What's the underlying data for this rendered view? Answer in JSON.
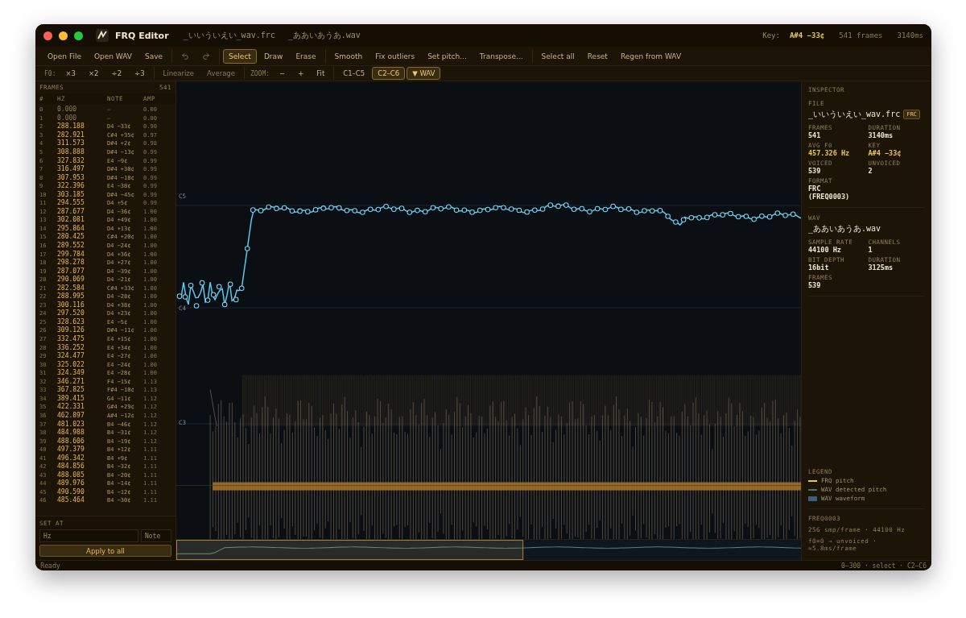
{
  "window": {
    "title": "FRQ Editor",
    "files": [
      "_いいういえい_wav.frc",
      "_ああいあうあ.wav"
    ],
    "key_label": "Key:",
    "key_value": "A#4 −33¢",
    "frames": "541 frames",
    "duration": "3140ms"
  },
  "toolbar": [
    [
      {
        "kind": "text",
        "label": "Open File",
        "selected": false,
        "disabled": false
      },
      {
        "kind": "text",
        "label": "Open WAV",
        "selected": false,
        "disabled": false
      },
      {
        "kind": "text",
        "label": "Save",
        "selected": false,
        "disabled": false
      }
    ],
    [
      {
        "kind": "undo",
        "selected": false,
        "disabled": true
      },
      {
        "kind": "redo",
        "selected": false,
        "disabled": true
      }
    ],
    [
      {
        "kind": "text",
        "label": "Select",
        "selected": true,
        "disabled": false
      },
      {
        "kind": "text",
        "label": "Draw",
        "selected": false,
        "disabled": false
      },
      {
        "kind": "text",
        "label": "Erase",
        "selected": false,
        "disabled": false
      }
    ],
    [
      {
        "kind": "text",
        "label": "Smooth",
        "selected": false,
        "disabled": false
      },
      {
        "kind": "text",
        "label": "Fix outliers",
        "selected": false,
        "disabled": false
      },
      {
        "kind": "text",
        "label": "Set pitch...",
        "selected": false,
        "disabled": false
      },
      {
        "kind": "text",
        "label": "Transpose...",
        "selected": false,
        "disabled": false
      }
    ],
    [
      {
        "kind": "text",
        "label": "Select all",
        "selected": false,
        "disabled": false
      },
      {
        "kind": "text",
        "label": "Reset",
        "selected": false,
        "disabled": false
      },
      {
        "kind": "text",
        "label": "Regen from WAV",
        "selected": false,
        "disabled": false
      }
    ]
  ],
  "toolbar2": [
    [
      {
        "kind": "label",
        "label": "F0:"
      },
      {
        "kind": "text",
        "label": "×3",
        "selected": false,
        "disabled": false
      },
      {
        "kind": "text",
        "label": "×2",
        "selected": false,
        "disabled": false
      },
      {
        "kind": "text",
        "label": "÷2",
        "selected": false,
        "disabled": false
      },
      {
        "kind": "text",
        "label": "÷3",
        "selected": false,
        "disabled": false
      }
    ],
    [
      {
        "kind": "text",
        "label": "Linearize",
        "selected": false,
        "disabled": true
      },
      {
        "kind": "text",
        "label": "Average",
        "selected": false,
        "disabled": true
      }
    ],
    [
      {
        "kind": "label",
        "label": "ZOOM:"
      },
      {
        "kind": "text",
        "label": "−",
        "selected": false,
        "disabled": false
      },
      {
        "kind": "text",
        "label": "+",
        "selected": false,
        "disabled": false
      },
      {
        "kind": "text",
        "label": "Fit",
        "selected": false,
        "disabled": false
      }
    ],
    [
      {
        "kind": "text",
        "label": "C1–C5",
        "selected": false,
        "disabled": false
      },
      {
        "kind": "text",
        "label": "C2–C6",
        "selected": true,
        "disabled": false
      },
      {
        "kind": "text",
        "label": "▼ WAV",
        "selected": true,
        "disabled": false
      }
    ]
  ],
  "frames_panel": {
    "title": "FRAMES",
    "count": "541",
    "columns": [
      "#",
      "HZ",
      "NOTE",
      "AMP"
    ],
    "rows": [
      {
        "index": "0",
        "hz": "0.000",
        "note": "–",
        "amp": "0.00",
        "voiced": false
      },
      {
        "index": "1",
        "hz": "0.000",
        "note": "–",
        "amp": "0.00",
        "voiced": false
      },
      {
        "index": "2",
        "hz": "288.188",
        "note": "D4 −33¢",
        "amp": "0.90",
        "voiced": true
      },
      {
        "index": "3",
        "hz": "282.921",
        "note": "C#4 +35¢",
        "amp": "0.97",
        "voiced": true
      },
      {
        "index": "4",
        "hz": "311.573",
        "note": "D#4 +2¢",
        "amp": "0.98",
        "voiced": true
      },
      {
        "index": "5",
        "hz": "308.888",
        "note": "D#4 −13¢",
        "amp": "0.99",
        "voiced": true
      },
      {
        "index": "6",
        "hz": "327.832",
        "note": "E4 −9¢",
        "amp": "0.99",
        "voiced": true
      },
      {
        "index": "7",
        "hz": "316.497",
        "note": "D#4 +30¢",
        "amp": "0.99",
        "voiced": true
      },
      {
        "index": "8",
        "hz": "307.953",
        "note": "D#4 −18¢",
        "amp": "0.99",
        "voiced": true
      },
      {
        "index": "9",
        "hz": "322.396",
        "note": "E4 −38¢",
        "amp": "0.99",
        "voiced": true
      },
      {
        "index": "10",
        "hz": "303.185",
        "note": "D#4 −45¢",
        "amp": "0.99",
        "voiced": true
      },
      {
        "index": "11",
        "hz": "294.555",
        "note": "D4 +5¢",
        "amp": "0.99",
        "voiced": true
      },
      {
        "index": "12",
        "hz": "287.677",
        "note": "D4 −36¢",
        "amp": "1.00",
        "voiced": true
      },
      {
        "index": "13",
        "hz": "302.081",
        "note": "D4 +49¢",
        "amp": "1.00",
        "voiced": true
      },
      {
        "index": "14",
        "hz": "295.864",
        "note": "D4 +13¢",
        "amp": "1.00",
        "voiced": true
      },
      {
        "index": "15",
        "hz": "280.425",
        "note": "C#4 +20¢",
        "amp": "1.00",
        "voiced": true
      },
      {
        "index": "16",
        "hz": "289.552",
        "note": "D4 −24¢",
        "amp": "1.00",
        "voiced": true
      },
      {
        "index": "17",
        "hz": "299.784",
        "note": "D4 +36¢",
        "amp": "1.00",
        "voiced": true
      },
      {
        "index": "18",
        "hz": "298.278",
        "note": "D4 +27¢",
        "amp": "1.00",
        "voiced": true
      },
      {
        "index": "19",
        "hz": "287.077",
        "note": "D4 −39¢",
        "amp": "1.00",
        "voiced": true
      },
      {
        "index": "20",
        "hz": "290.069",
        "note": "D4 −21¢",
        "amp": "1.00",
        "voiced": true
      },
      {
        "index": "21",
        "hz": "282.584",
        "note": "C#4 +33¢",
        "amp": "1.00",
        "voiced": true
      },
      {
        "index": "22",
        "hz": "288.995",
        "note": "D4 −28¢",
        "amp": "1.00",
        "voiced": true
      },
      {
        "index": "23",
        "hz": "300.116",
        "note": "D4 +38¢",
        "amp": "1.00",
        "voiced": true
      },
      {
        "index": "24",
        "hz": "297.520",
        "note": "D4 +23¢",
        "amp": "1.00",
        "voiced": true
      },
      {
        "index": "25",
        "hz": "328.623",
        "note": "E4 −5¢",
        "amp": "1.00",
        "voiced": true
      },
      {
        "index": "26",
        "hz": "309.126",
        "note": "D#4 −11¢",
        "amp": "1.00",
        "voiced": true
      },
      {
        "index": "27",
        "hz": "332.475",
        "note": "E4 +15¢",
        "amp": "1.00",
        "voiced": true
      },
      {
        "index": "28",
        "hz": "336.252",
        "note": "E4 +34¢",
        "amp": "1.00",
        "voiced": true
      },
      {
        "index": "29",
        "hz": "324.477",
        "note": "E4 −27¢",
        "amp": "1.00",
        "voiced": true
      },
      {
        "index": "30",
        "hz": "325.022",
        "note": "E4 −24¢",
        "amp": "1.00",
        "voiced": true
      },
      {
        "index": "31",
        "hz": "324.349",
        "note": "E4 −28¢",
        "amp": "1.00",
        "voiced": true
      },
      {
        "index": "32",
        "hz": "346.271",
        "note": "F4 −15¢",
        "amp": "1.13",
        "voiced": true
      },
      {
        "index": "33",
        "hz": "367.825",
        "note": "F#4 −10¢",
        "amp": "1.13",
        "voiced": true
      },
      {
        "index": "34",
        "hz": "389.415",
        "note": "G4 −11¢",
        "amp": "1.12",
        "voiced": true
      },
      {
        "index": "35",
        "hz": "422.331",
        "note": "G#4 +29¢",
        "amp": "1.12",
        "voiced": true
      },
      {
        "index": "36",
        "hz": "462.897",
        "note": "A#4 −12¢",
        "amp": "1.12",
        "voiced": true
      },
      {
        "index": "37",
        "hz": "481.023",
        "note": "B4 −46¢",
        "amp": "1.12",
        "voiced": true
      },
      {
        "index": "38",
        "hz": "484.988",
        "note": "B4 −31¢",
        "amp": "1.12",
        "voiced": true
      },
      {
        "index": "39",
        "hz": "488.606",
        "note": "B4 −19¢",
        "amp": "1.12",
        "voiced": true
      },
      {
        "index": "40",
        "hz": "497.379",
        "note": "B4 +12¢",
        "amp": "1.11",
        "voiced": true
      },
      {
        "index": "41",
        "hz": "496.342",
        "note": "B4 +9¢",
        "amp": "1.11",
        "voiced": true
      },
      {
        "index": "42",
        "hz": "484.856",
        "note": "B4 −32¢",
        "amp": "1.11",
        "voiced": true
      },
      {
        "index": "43",
        "hz": "488.085",
        "note": "B4 −20¢",
        "amp": "1.11",
        "voiced": true
      },
      {
        "index": "44",
        "hz": "489.976",
        "note": "B4 −14¢",
        "amp": "1.11",
        "voiced": true
      },
      {
        "index": "45",
        "hz": "490.590",
        "note": "B4 −12¢",
        "amp": "1.11",
        "voiced": true
      },
      {
        "index": "46",
        "hz": "485.464",
        "note": "B4 −30¢",
        "amp": "1.11",
        "voiced": true
      }
    ]
  },
  "set_at": {
    "title": "SET AT",
    "hz_placeholder": "Hz",
    "note_placeholder": "Note",
    "button": "Apply to all"
  },
  "plot": {
    "octave_labels": [
      "C5",
      "C4",
      "C3"
    ]
  },
  "inspector": {
    "title": "INSPECTOR",
    "sections": [
      {
        "title": "FILE",
        "name": "_いいういえい_wav.frc",
        "badge": "FRC",
        "fields": [
          {
            "label": "FRAMES",
            "value": "541",
            "kind": "plain"
          },
          {
            "label": "DURATION",
            "value": "3140ms",
            "kind": "plain"
          },
          {
            "label": "AVG F0",
            "value": "457.326 Hz",
            "kind": "accent"
          },
          {
            "label": "KEY",
            "value": "A#4 −33¢",
            "kind": "accent"
          },
          {
            "label": "VOICED",
            "value": "539",
            "kind": "plain"
          },
          {
            "label": "UNVOICED",
            "value": "2",
            "kind": "plain"
          },
          {
            "label": "FORMAT",
            "value": "FRC (FREQ0003)",
            "kind": "plain"
          }
        ]
      },
      {
        "title": "WAV",
        "name": "_ああいあうあ.wav",
        "fields": [
          {
            "label": "SAMPLE RATE",
            "value": "44100 Hz",
            "kind": "plain"
          },
          {
            "label": "CHANNELS",
            "value": "1",
            "kind": "plain"
          },
          {
            "label": "BIT DEPTH",
            "value": "16bit",
            "kind": "plain"
          },
          {
            "label": "DURATION",
            "value": "3125ms",
            "kind": "plain"
          },
          {
            "label": "FRAMES",
            "value": "539",
            "kind": "plain"
          }
        ]
      }
    ],
    "legend": {
      "title": "LEGEND",
      "items": [
        {
          "label": "FRQ pitch",
          "color": "#e8c45a",
          "kind": "line"
        },
        {
          "label": "WAV detected pitch",
          "color": "#4f6f6a",
          "kind": "line"
        },
        {
          "label": "WAV waveform",
          "color": "#3a5d80",
          "kind": "block"
        }
      ]
    },
    "footer": [
      "FREQ0003",
      "256 smp/frame · 44100 Hz",
      "f0=0 → unvoiced · ≈5.8ms/frame"
    ]
  },
  "status_bar": {
    "left": "Ready",
    "right": "0–300 · select · C2–C6"
  }
}
